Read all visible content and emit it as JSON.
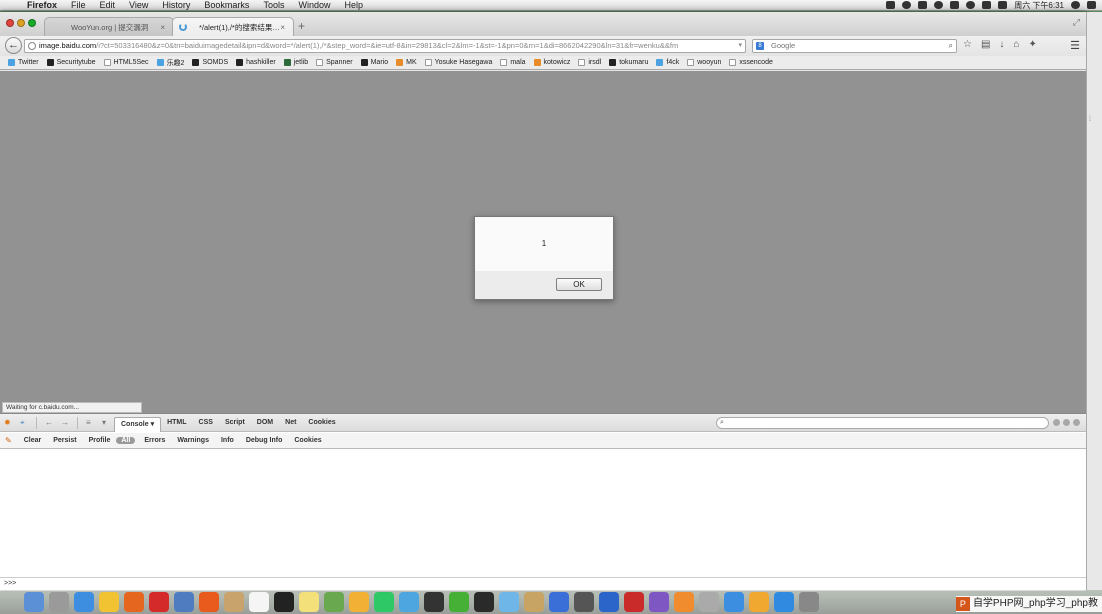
{
  "menubar": {
    "app": "Firefox",
    "items": [
      "File",
      "Edit",
      "View",
      "History",
      "Bookmarks",
      "Tools",
      "Window",
      "Help"
    ],
    "clock": "周六 下午6:31"
  },
  "tabs": [
    {
      "title": "WooYun.org | 提交漏洞",
      "close": "×"
    },
    {
      "title": "*/alert(1),/*的搜索结果_百...",
      "close": "×"
    }
  ],
  "new_tab": "+",
  "navbar": {
    "url_host": "image.baidu.com",
    "url_rest": "/i?ct=503316480&z=0&tn=baiduimagedetail&ipn=d&word=*/alert(1),/*&step_word=&ie=utf-8&in=29813&cl=2&lm=-1&st=-1&pn=0&rn=1&di=8662042290&ln=31&fr=wenku&&fm",
    "search_placeholder": "Google"
  },
  "bookmarks": [
    {
      "label": "Twitter",
      "kind": "blue"
    },
    {
      "label": "Securitytube",
      "kind": "dark"
    },
    {
      "label": "HTML5Sec",
      "kind": "page"
    },
    {
      "label": "乐趣2",
      "kind": "blue"
    },
    {
      "label": "SOMDS",
      "kind": "dark"
    },
    {
      "label": "hashkiller",
      "kind": "dark"
    },
    {
      "label": "jetlib",
      "kind": "green"
    },
    {
      "label": "Spanner",
      "kind": "page"
    },
    {
      "label": "Mario",
      "kind": "dark"
    },
    {
      "label": "MK",
      "kind": "orange"
    },
    {
      "label": "Yosuke Hasegawa",
      "kind": "page"
    },
    {
      "label": "mala",
      "kind": "page"
    },
    {
      "label": "kotowicz",
      "kind": "orange"
    },
    {
      "label": "irsdl",
      "kind": "page"
    },
    {
      "label": "tokumaru",
      "kind": "dark"
    },
    {
      "label": "f4ck",
      "kind": "blue"
    },
    {
      "label": "wooyun",
      "kind": "page"
    },
    {
      "label": "xssencode",
      "kind": "page"
    }
  ],
  "status": "Waiting for c.baidu.com...",
  "alert": {
    "message": "1",
    "ok": "OK"
  },
  "firebug": {
    "tabs": [
      "Console",
      "HTML",
      "CSS",
      "Script",
      "DOM",
      "Net",
      "Cookies"
    ],
    "console_dropdown": "▾",
    "subbar": [
      "Clear",
      "Persist",
      "Profile"
    ],
    "filters": [
      "All",
      "Errors",
      "Warnings",
      "Info",
      "Debug Info",
      "Cookies"
    ],
    "prompt": ">>>"
  },
  "watermark": {
    "icon": "P",
    "text": "自学PHP网_php学习_php教"
  }
}
